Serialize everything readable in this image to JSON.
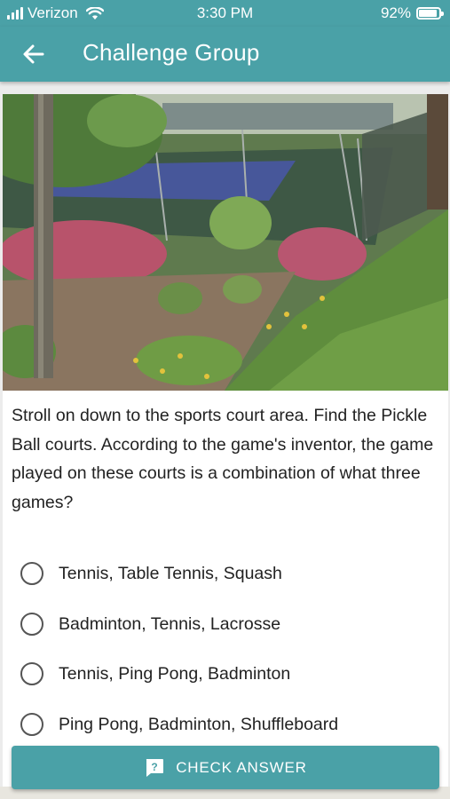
{
  "status_bar": {
    "carrier": "Verizon",
    "time": "3:30 PM",
    "battery": "92%",
    "battery_level": 0.92
  },
  "app_bar": {
    "title": "Challenge Group"
  },
  "question": {
    "text": "Stroll on down to the sports court area. Find the Pickle Ball courts. According to the game's inventor, the game played on these courts is a combination of what three games?"
  },
  "options": [
    {
      "label": "Tennis, Table Tennis, Squash"
    },
    {
      "label": "Badminton, Tennis, Lacrosse"
    },
    {
      "label": "Tennis, Ping Pong, Badminton"
    },
    {
      "label": "Ping Pong, Badminton, Shuffleboard"
    }
  ],
  "check_button": {
    "label": "CHECK ANSWER"
  },
  "colors": {
    "accent": "#4aa1a7"
  }
}
